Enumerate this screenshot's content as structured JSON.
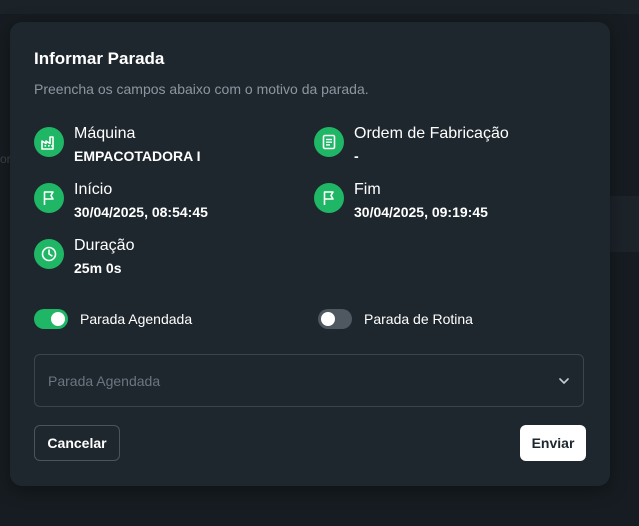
{
  "background": {
    "fragment_text": "or"
  },
  "modal": {
    "title": "Informar Parada",
    "subtitle": "Preencha os campos abaixo com o motivo da parada.",
    "accent_color": "#1fb765",
    "info": {
      "machine": {
        "icon": "factory-icon",
        "label": "Máquina",
        "value": "EMPACOTADORA I"
      },
      "order": {
        "icon": "document-icon",
        "label": "Ordem de Fabricação",
        "value": "-"
      },
      "start": {
        "icon": "flag-icon",
        "label": "Início",
        "value": "30/04/2025, 08:54:45"
      },
      "end": {
        "icon": "flag-icon",
        "label": "Fim",
        "value": "30/04/2025, 09:19:45"
      },
      "duration": {
        "icon": "clock-icon",
        "label": "Duração",
        "value": "25m 0s"
      }
    },
    "toggles": {
      "scheduled": {
        "label": "Parada Agendada",
        "on": true
      },
      "routine": {
        "label": "Parada de Rotina",
        "on": false
      }
    },
    "reason_select": {
      "placeholder": "Parada Agendada",
      "icon": "chevron-down-icon"
    },
    "buttons": {
      "cancel": "Cancelar",
      "send": "Enviar"
    }
  }
}
